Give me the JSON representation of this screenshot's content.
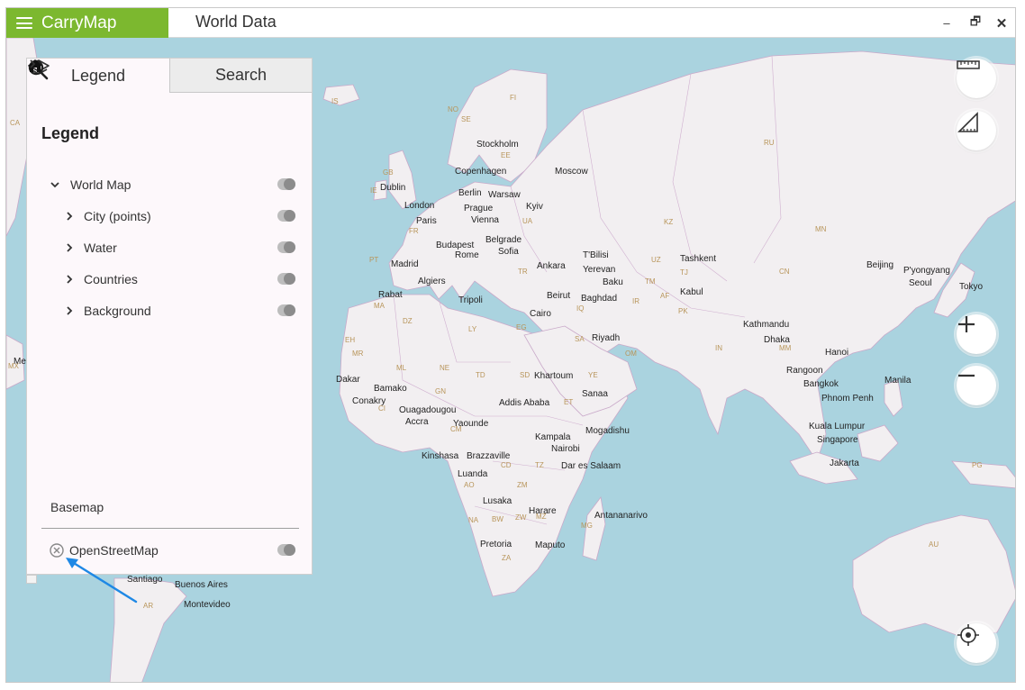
{
  "app": {
    "brand": "CarryMap",
    "document_title": "World Data",
    "window_controls": {
      "minimize": "–",
      "restore": "🗗",
      "close": "✕"
    }
  },
  "panel": {
    "tabs": [
      {
        "label": "Legend",
        "icon": "layers-icon",
        "active": true
      },
      {
        "label": "Search",
        "icon": "search-icon",
        "active": false
      }
    ],
    "legend_heading": "Legend",
    "layers": [
      {
        "label": "World Map",
        "level": 0,
        "expanded": true
      },
      {
        "label": "City (points)",
        "level": 1,
        "expanded": false
      },
      {
        "label": "Water",
        "level": 1,
        "expanded": false
      },
      {
        "label": "Countries",
        "level": 1,
        "expanded": false
      },
      {
        "label": "Background",
        "level": 1,
        "expanded": false
      }
    ],
    "basemap_label": "Basemap",
    "basemap_item": "OpenStreetMap"
  },
  "map": {
    "cities": [
      "Stockholm",
      "Copenhagen",
      "Moscow",
      "Dublin",
      "Berlin",
      "Warsaw",
      "London",
      "Prague",
      "Kyiv",
      "Paris",
      "Vienna",
      "Budapest",
      "Belgrade",
      "Rome",
      "Sofia",
      "T'Bilisi",
      "Tashkent",
      "Beijing",
      "P'yongyang",
      "Madrid",
      "Ankara",
      "Yerevan",
      "Baku",
      "Seoul",
      "Tokyo",
      "Algiers",
      "Rabat",
      "Tripoli",
      "Beirut",
      "Baghdad",
      "Kabul",
      "Cairo",
      "Kathmandu",
      "Riyadh",
      "Dhaka",
      "Hanoi",
      "Dakar",
      "Bamako",
      "Khartoum",
      "Rangoon",
      "Manila",
      "Bangkok",
      "Conakry",
      "Addis Ababa",
      "Sanaa",
      "Phnom Penh",
      "Ouagadougou",
      "Accra",
      "Yaounde",
      "Mogadishu",
      "Kuala Lumpur",
      "Kampala",
      "Nairobi",
      "Singapore",
      "Kinshasa",
      "Brazzaville",
      "Dar es Salaam",
      "Jakarta",
      "Luanda",
      "Lusaka",
      "Harare",
      "Antananarivo",
      "Pretoria",
      "Maputo",
      "Santiago",
      "Buenos Aires",
      "Montevideo",
      "Me"
    ],
    "country_codes": [
      "IS",
      "CA",
      "NO",
      "FI",
      "SE",
      "RU",
      "EE",
      "GB",
      "IE",
      "UA",
      "KZ",
      "MN",
      "FR",
      "PT",
      "TR",
      "UZ",
      "TM",
      "TJ",
      "CN",
      "MA",
      "DZ",
      "IR",
      "AF",
      "PK",
      "LY",
      "EG",
      "IQ",
      "SA",
      "EH",
      "MR",
      "OM",
      "IN",
      "MM",
      "ML",
      "NE",
      "TD",
      "SD",
      "YE",
      "GN",
      "CI",
      "ET",
      "CM",
      "CD",
      "TZ",
      "AO",
      "ZM",
      "NA",
      "BW",
      "ZW",
      "MZ",
      "MG",
      "ZA",
      "AR",
      "PG",
      "AU",
      "MX"
    ]
  },
  "colors": {
    "accent": "#7cb82f",
    "water": "#aad3df",
    "land": "#f2eff1",
    "border": "#c9a9c9"
  }
}
